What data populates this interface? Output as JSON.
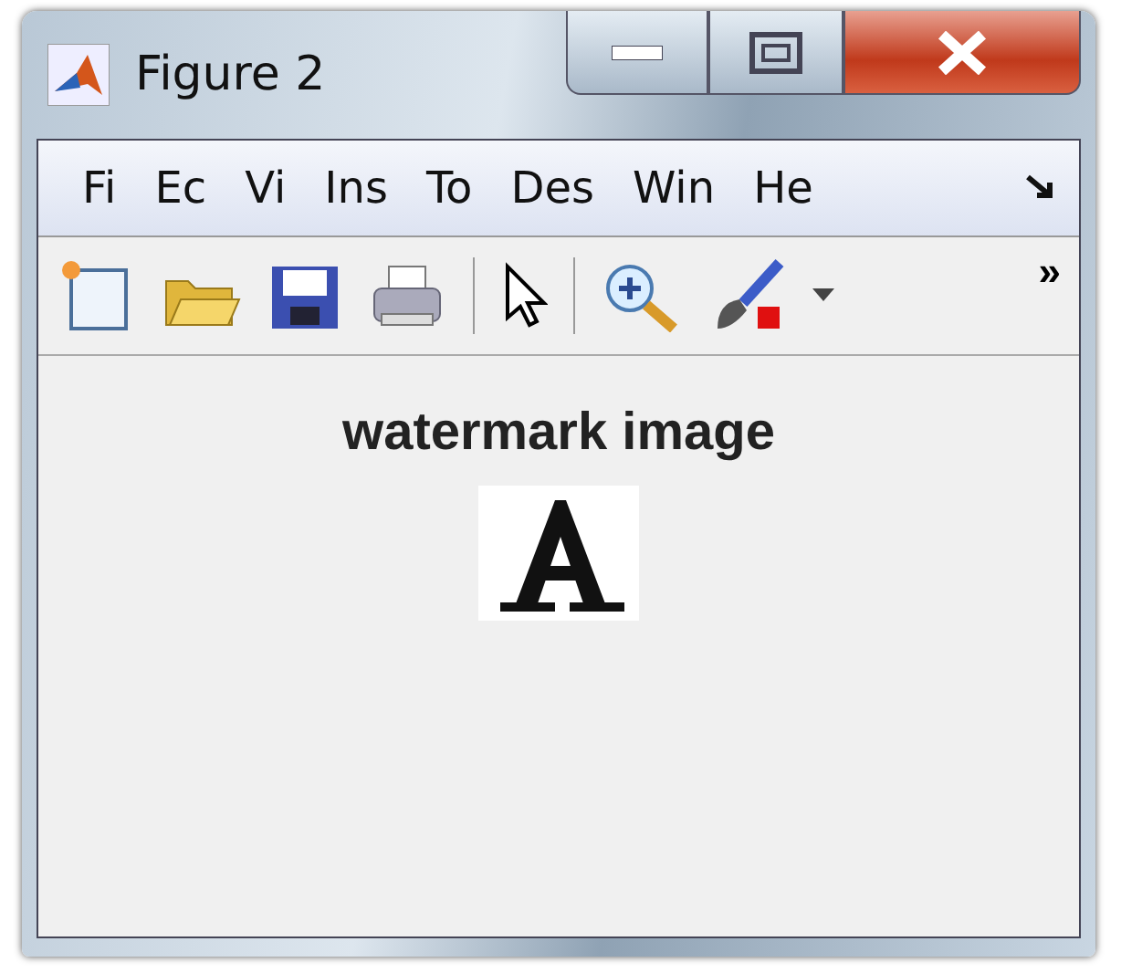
{
  "window": {
    "title": "Figure 2"
  },
  "menu": [
    "Fi",
    "Ec",
    "Vi",
    "Ins",
    "To",
    "Des",
    "Win",
    "He"
  ],
  "toolbar": {
    "overflow": "»"
  },
  "figure": {
    "title": "watermark image"
  }
}
